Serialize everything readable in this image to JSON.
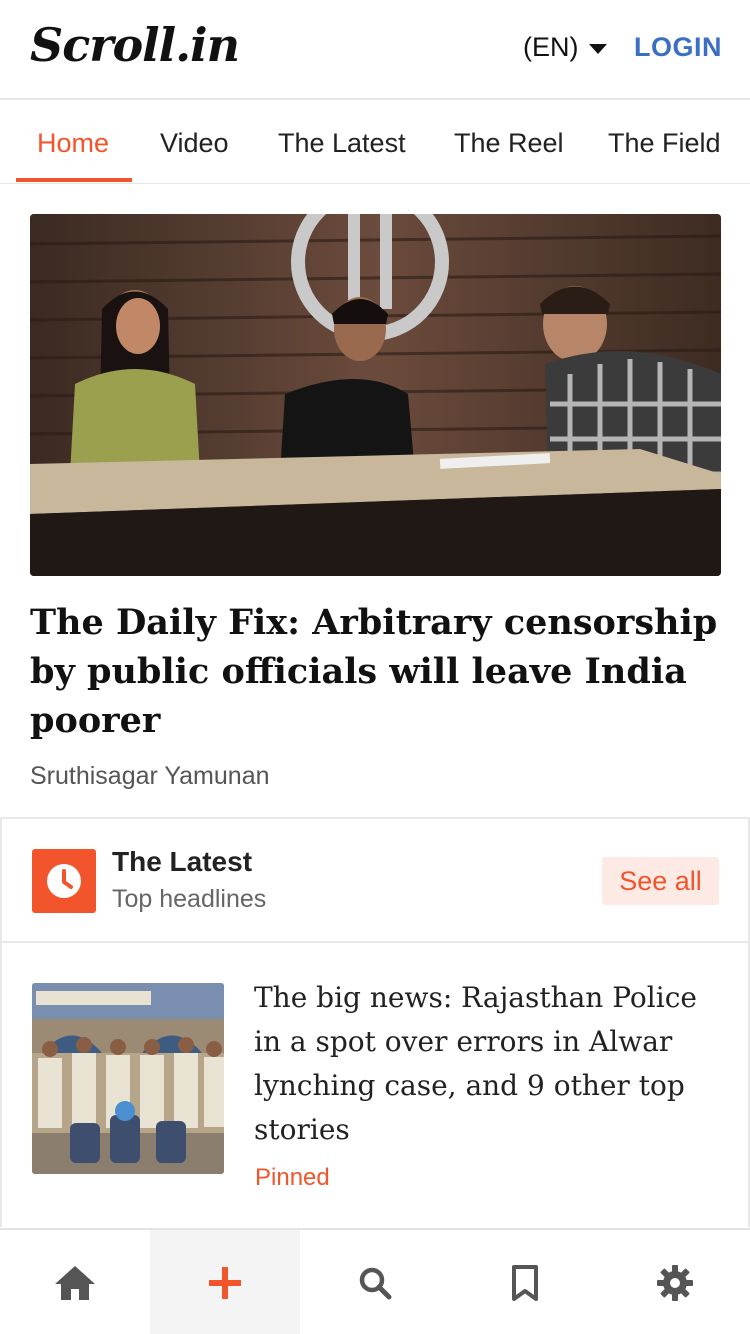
{
  "header": {
    "logo_text": "Scroll.in",
    "language": "(EN)",
    "login_label": "LOGIN"
  },
  "tabs": [
    {
      "label": "Home",
      "active": true
    },
    {
      "label": "Video",
      "active": false
    },
    {
      "label": "The Latest",
      "active": false
    },
    {
      "label": "The Reel",
      "active": false
    },
    {
      "label": "The Field",
      "active": false
    }
  ],
  "hero": {
    "title": "The Daily Fix: Arbitrary censorship by public officials will leave India poorer",
    "author": "Sruthisagar Yamunan"
  },
  "latest": {
    "title": "The Latest",
    "subtitle": "Top headlines",
    "see_all_label": "See all",
    "stories": [
      {
        "title": "The big news: Rajasthan Police in a spot over errors in Alwar lynching case, and 9 other top stories",
        "tag": "Pinned"
      }
    ]
  },
  "bottom_nav": [
    {
      "icon": "home-icon",
      "active": false
    },
    {
      "icon": "plus-icon",
      "active": true
    },
    {
      "icon": "search-icon",
      "active": false
    },
    {
      "icon": "bookmark-icon",
      "active": false
    },
    {
      "icon": "gear-icon",
      "active": false
    }
  ],
  "colors": {
    "accent": "#f2552c",
    "login": "#3a6fc4",
    "icon_gray": "#555555"
  }
}
